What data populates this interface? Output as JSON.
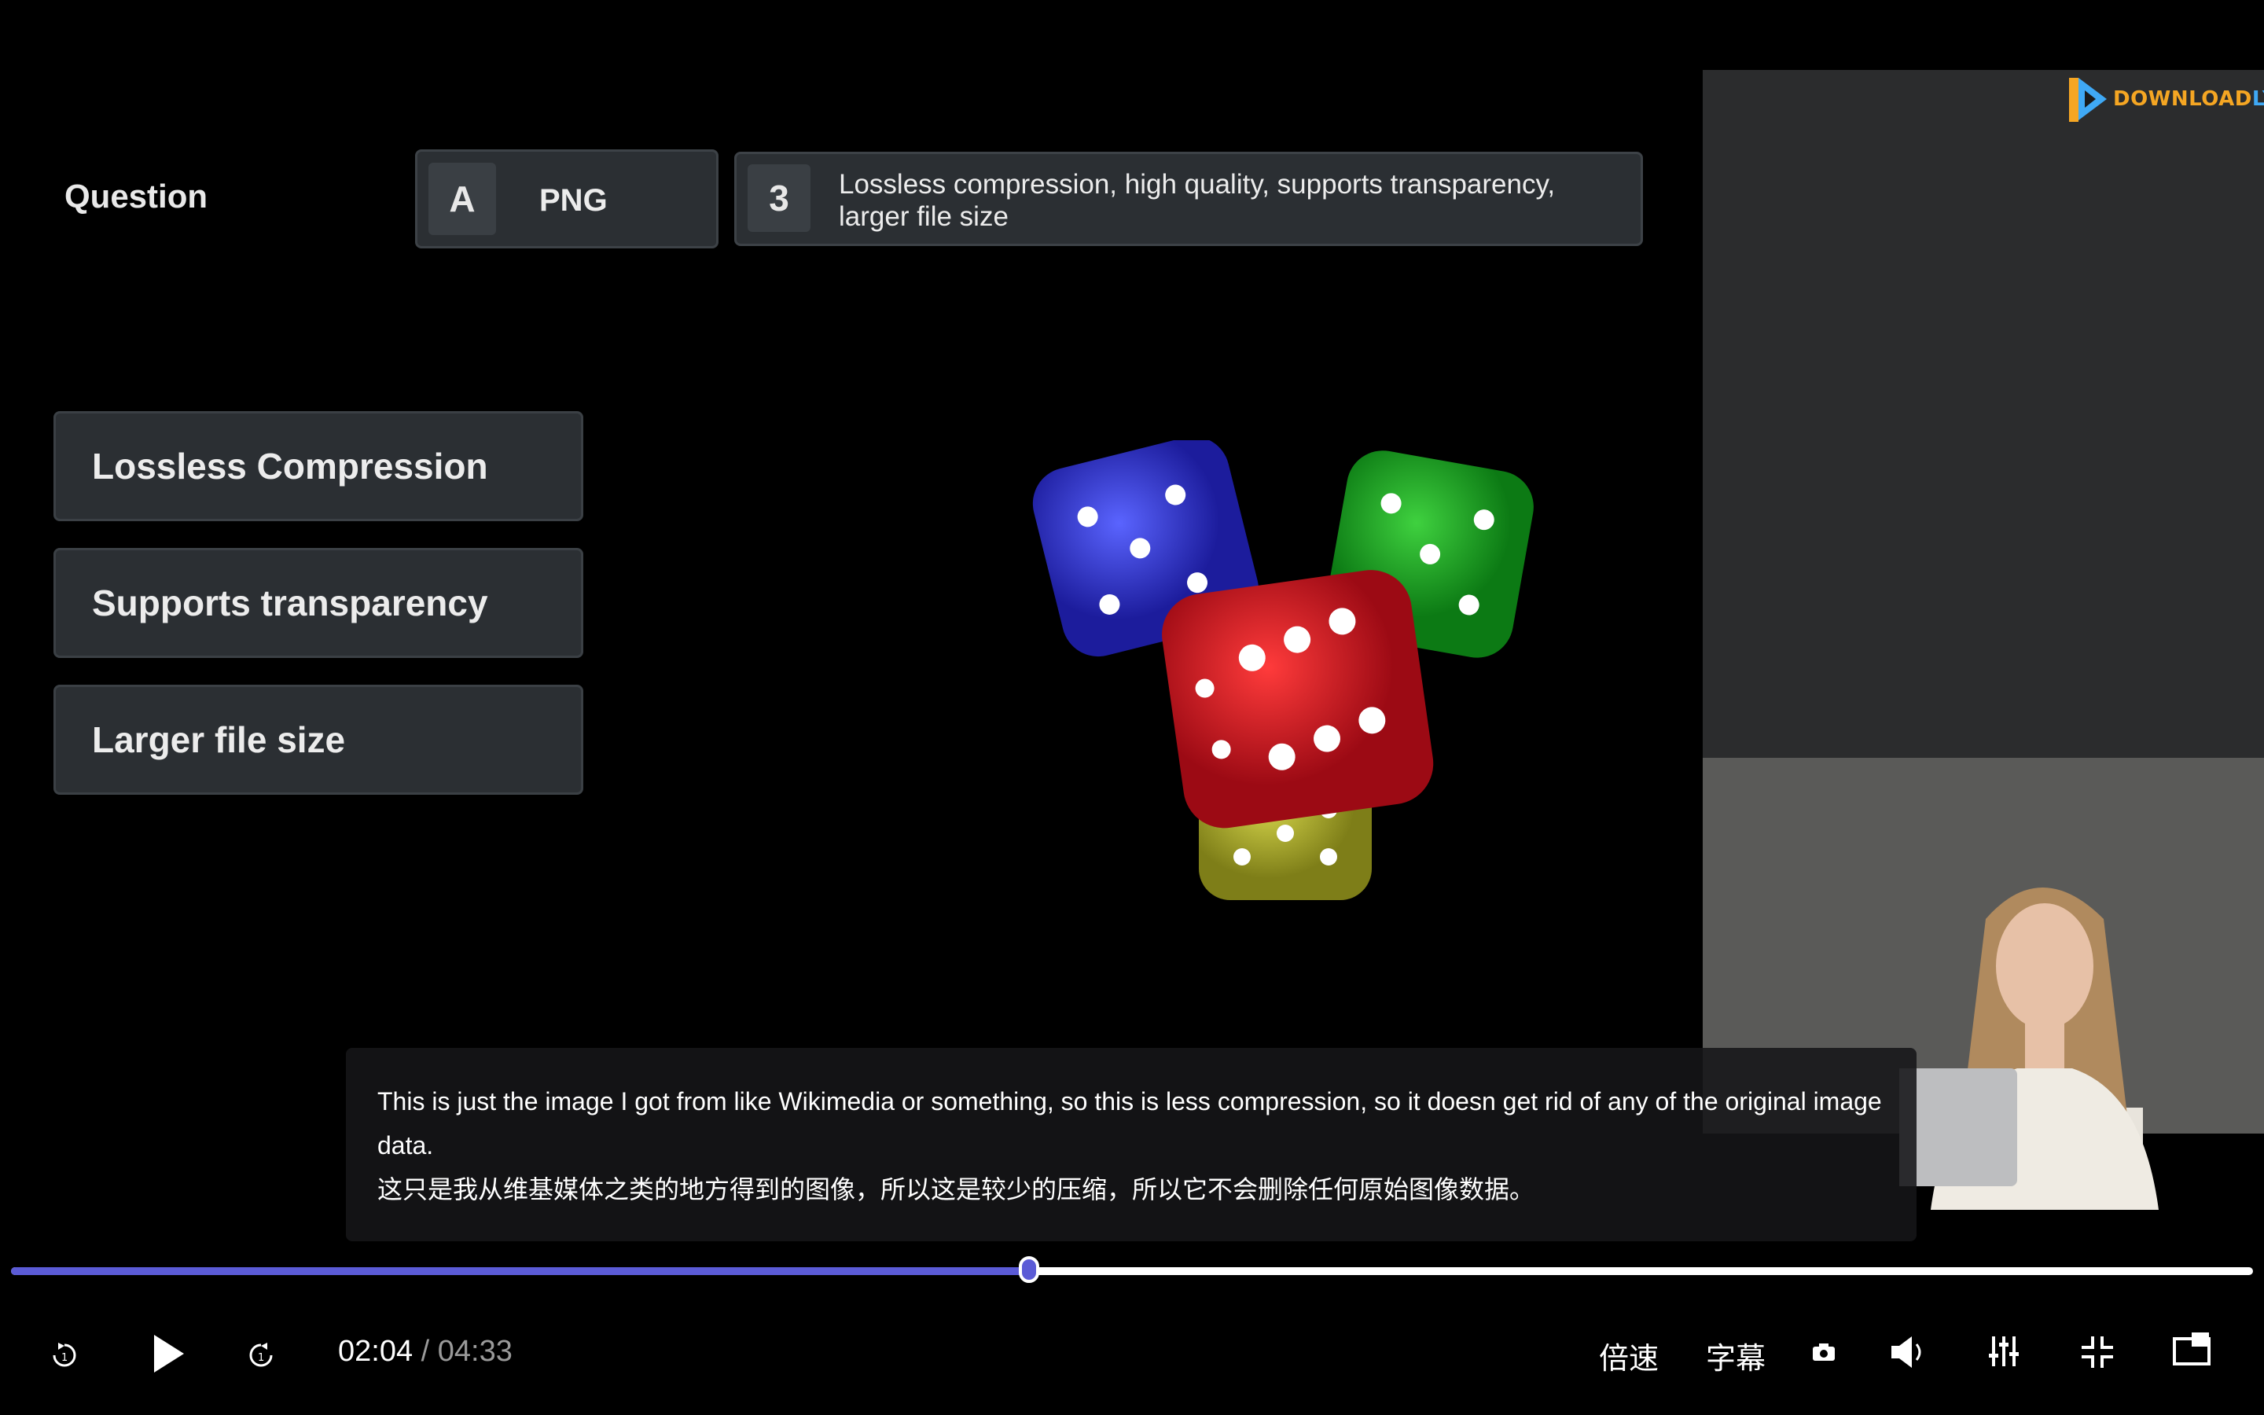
{
  "slide": {
    "question_label": "Question",
    "answer_key": "A",
    "answer_value": "PNG",
    "number_key": "3",
    "number_text": "Lossless compression, high quality, supports transparency, larger file size",
    "options": [
      "Lossless Compression",
      "Supports transparency",
      "Larger file size"
    ]
  },
  "watermark": {
    "text_a": "DOWNLOAD",
    "text_b": "LY.IR"
  },
  "caption": {
    "english": "This is just the image I got from like Wikimedia or something, so this is less compression, so it doesn get rid of any of the original image data.",
    "chinese": "这只是我从维基媒体之类的地方得到的图像，所以这是较少的压缩，所以它不会删除任何原始图像数据。"
  },
  "player": {
    "current_time": "02:04",
    "separator": "/",
    "duration": "04:33",
    "progress_fraction": 0.454,
    "speed_label": "倍速",
    "subtitle_label": "字幕",
    "accent_color": "#5b5bd6"
  }
}
